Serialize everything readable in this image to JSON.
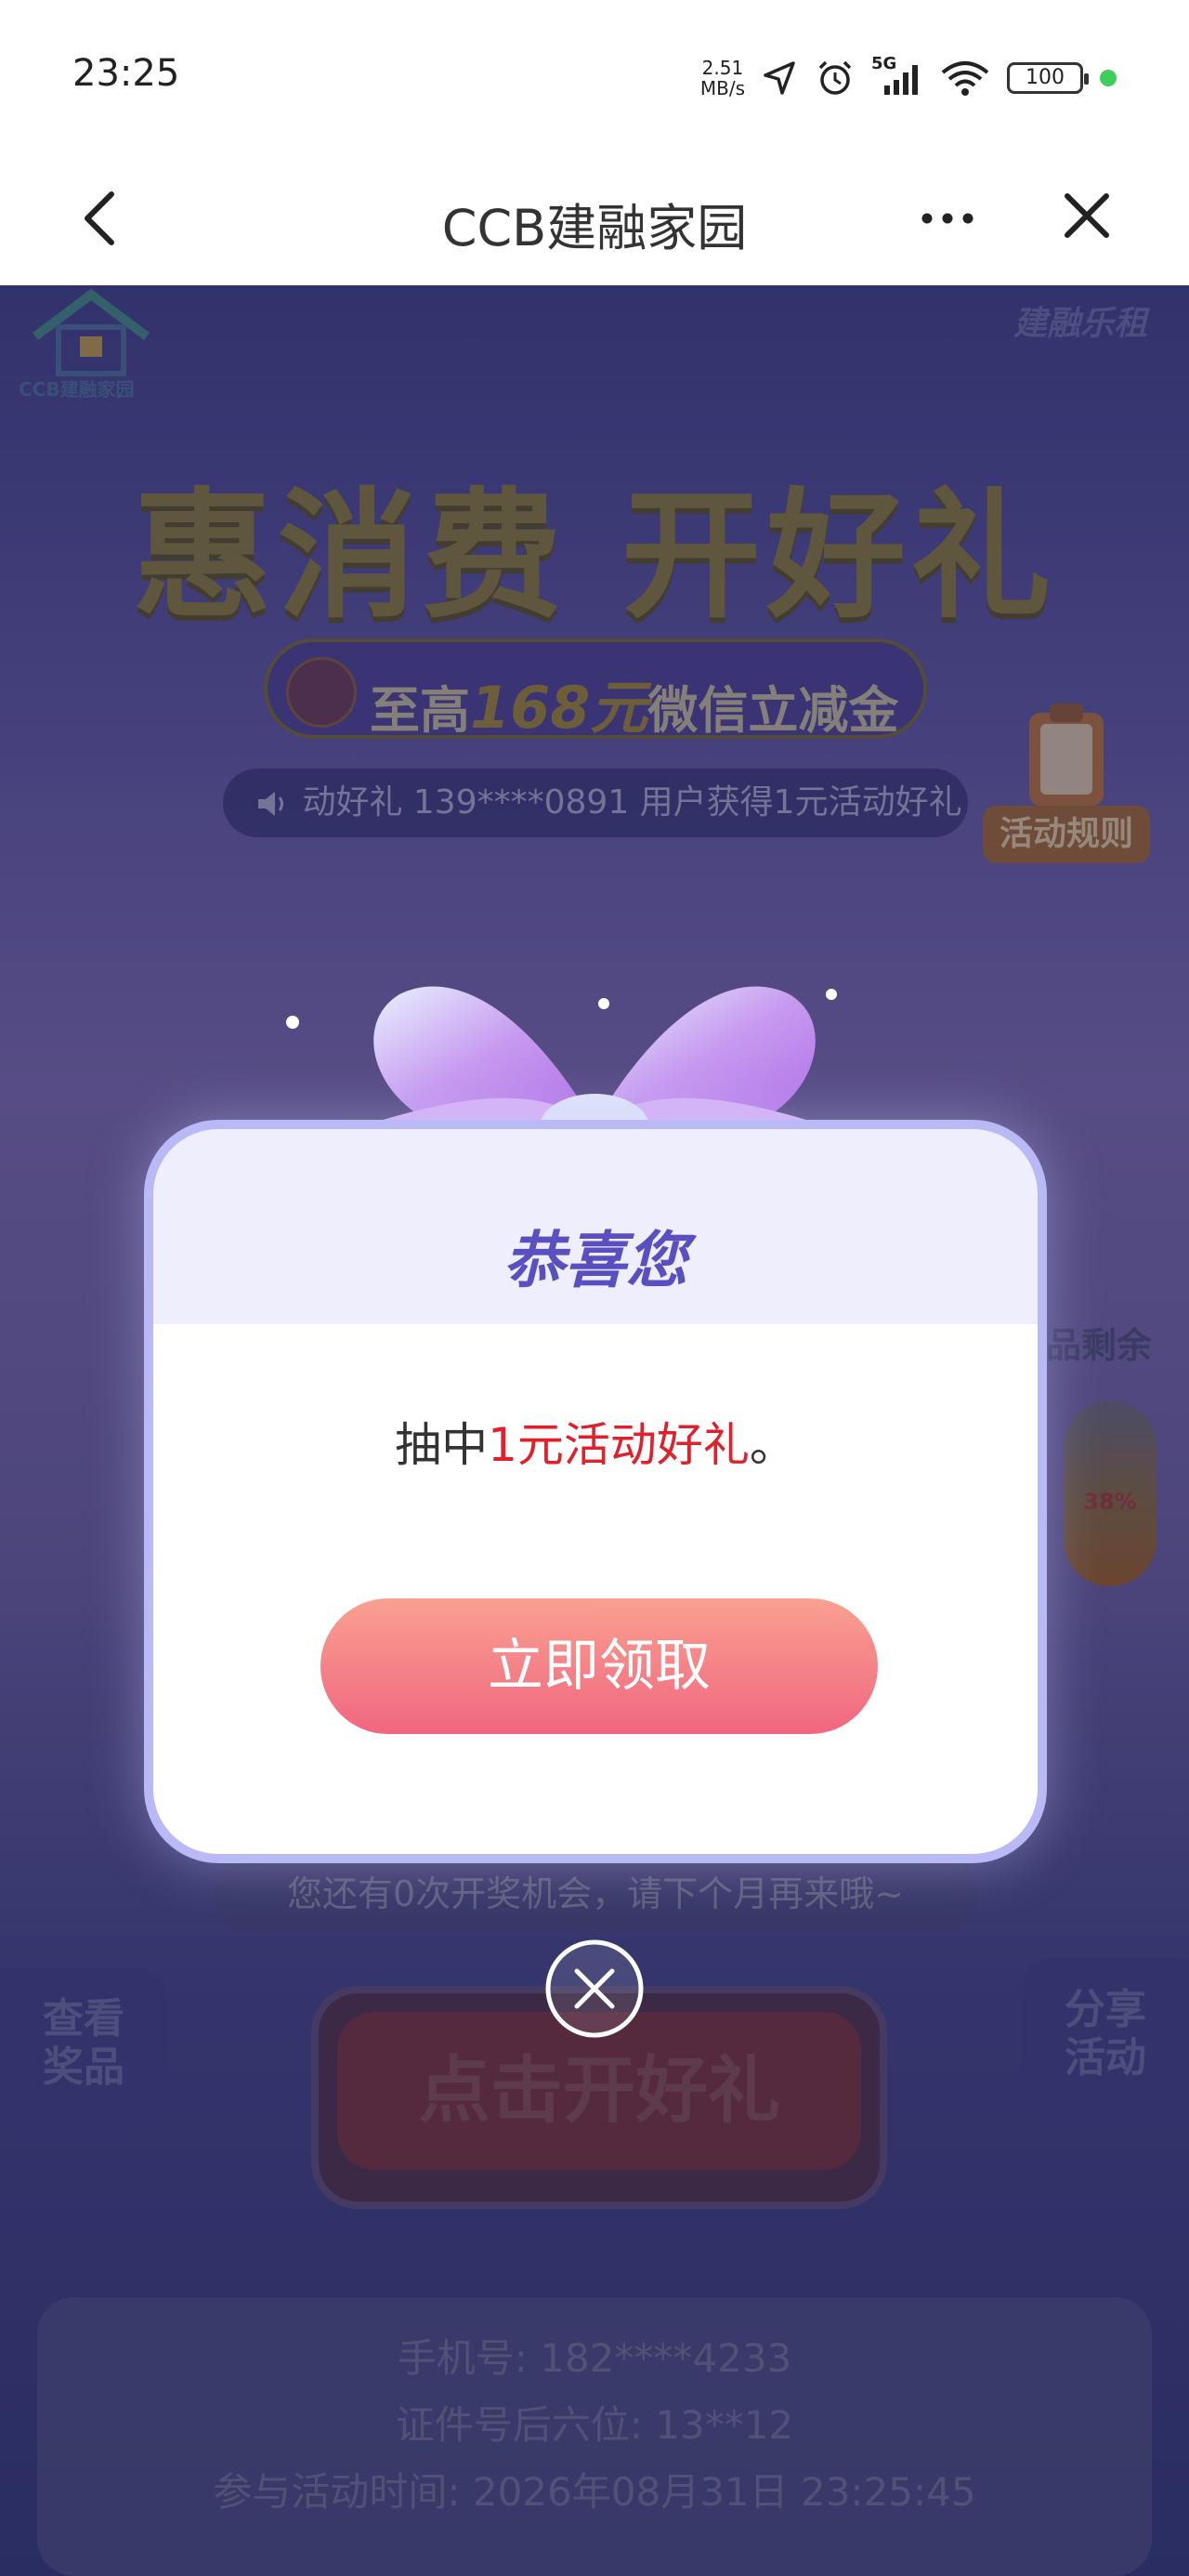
{
  "status_bar": {
    "time": "23:25",
    "speed_value": "2.51",
    "speed_unit": "MB/s",
    "network": "5G",
    "battery": "100"
  },
  "header": {
    "title": "CCB建融家园",
    "back_icon": "chevron-left-icon",
    "more_icon": "more-icon",
    "close_icon": "close-icon"
  },
  "page": {
    "logo_text": "CCB建融家园",
    "brand_right": "建融乐租",
    "hero_title": "惠消费 开好礼",
    "hero_pill_prefix": "至高",
    "hero_pill_amount": "168元",
    "hero_pill_suffix": "微信立减金",
    "ticker_text": "动好礼      139****0891 用户获得1元活动好礼",
    "rules_label": "活动规则",
    "prize_remaining_label": "品剩余",
    "capsule_percent": "38%",
    "chance_text": "您还有0次开奖机会，请下个月再来哦~",
    "view_prizes": "查看\n奖品",
    "share_activity": "分享\n活动",
    "open_gift_button": "点击开好礼",
    "phone_line": "手机号: 182****4233",
    "id_line": "证件号后六位: 13**12",
    "time_line": "参与活动时间: 2026年08月31日 23:25:45"
  },
  "modal": {
    "title": "恭喜您",
    "msg_prefix": "抽中",
    "msg_prize": "1元活动好礼",
    "msg_suffix": "。",
    "claim_button": "立即领取",
    "close_icon": "close-circle-icon"
  },
  "colors": {
    "accent_red": "#e0212b",
    "claim_gradient_top": "#f9a190",
    "claim_gradient_bottom": "#f16680",
    "modal_title": "#5a4fc0"
  }
}
